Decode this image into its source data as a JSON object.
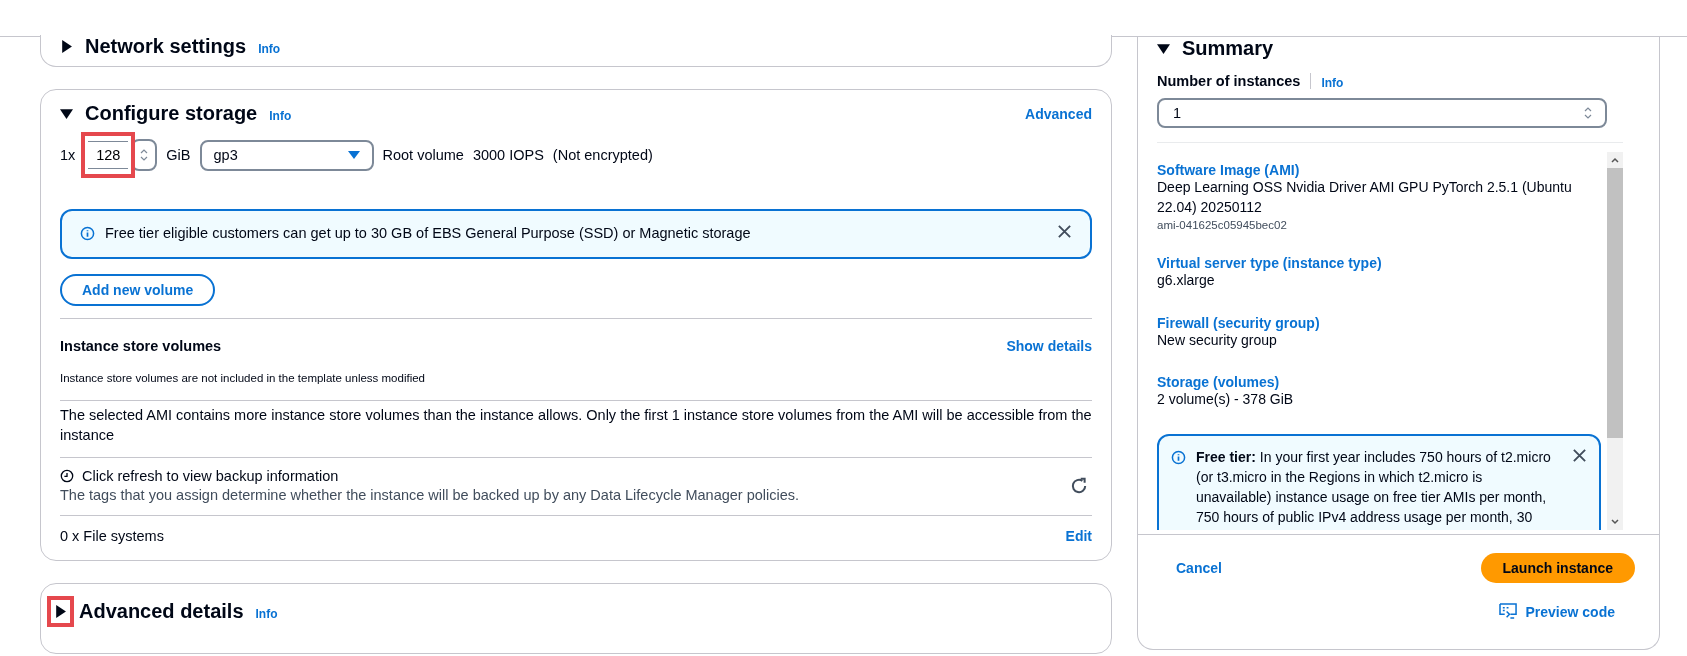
{
  "network_settings": {
    "title": "Network settings",
    "info": "Info",
    "expanded": false
  },
  "configure_storage": {
    "title": "Configure storage",
    "info": "Info",
    "expanded": true,
    "action": "Advanced",
    "volume": {
      "count": "1x",
      "size": "128",
      "highlighted": true,
      "unit": "GiB",
      "type": "gp3",
      "details": [
        "Root volume",
        "3000 IOPS",
        "(Not encrypted)"
      ]
    },
    "alert": {
      "text": "Free tier eligible customers can get up to 30 GB of EBS General Purpose (SSD) or Magnetic storage",
      "dismissible": true
    },
    "add_button": "Add new volume",
    "instance_store": {
      "title": "Instance store volumes",
      "action": "Show details",
      "note": "Instance store volumes are not included in the template unless modified",
      "warning": "The selected AMI contains more instance store volumes than the instance allows. Only the first 1 instance store volumes from the AMI will be accessible from the instance"
    },
    "backup": {
      "title": "Click refresh to view backup information",
      "description": "The tags that you assign determine whether the instance will be backed up by any Data Lifecycle Manager policies."
    },
    "file_systems": {
      "label": "0 x File systems",
      "action": "Edit"
    }
  },
  "advanced_details": {
    "title": "Advanced details",
    "info": "Info",
    "expanded": false,
    "highlighted": true
  },
  "summary": {
    "title": "Summary",
    "expanded": true,
    "instances": {
      "label": "Number of instances",
      "info": "Info",
      "value": "1"
    },
    "items": [
      {
        "label": "Software Image (AMI)",
        "value": "Deep Learning OSS Nvidia Driver AMI GPU PyTorch 2.5.1 (Ubuntu 22.04) 20250112",
        "sub": "ami-041625c05945bec02"
      },
      {
        "label": "Virtual server type (instance type)",
        "value": "g6.xlarge"
      },
      {
        "label": "Firewall (security group)",
        "value": "New security group"
      },
      {
        "label": "Storage (volumes)",
        "value": "2 volume(s) - 378 GiB"
      }
    ],
    "alert": {
      "text": "**Free tier:** In your first year includes 750 hours of t2.micro (or t3.micro in the Regions in which t2.micro is unavailable) instance usage on free tier AMIs per month, 750 hours of public IPv4 address usage per month, 30",
      "dismissible": true
    },
    "cancel": "Cancel",
    "launch": "Launch instance",
    "preview": "Preview code"
  }
}
